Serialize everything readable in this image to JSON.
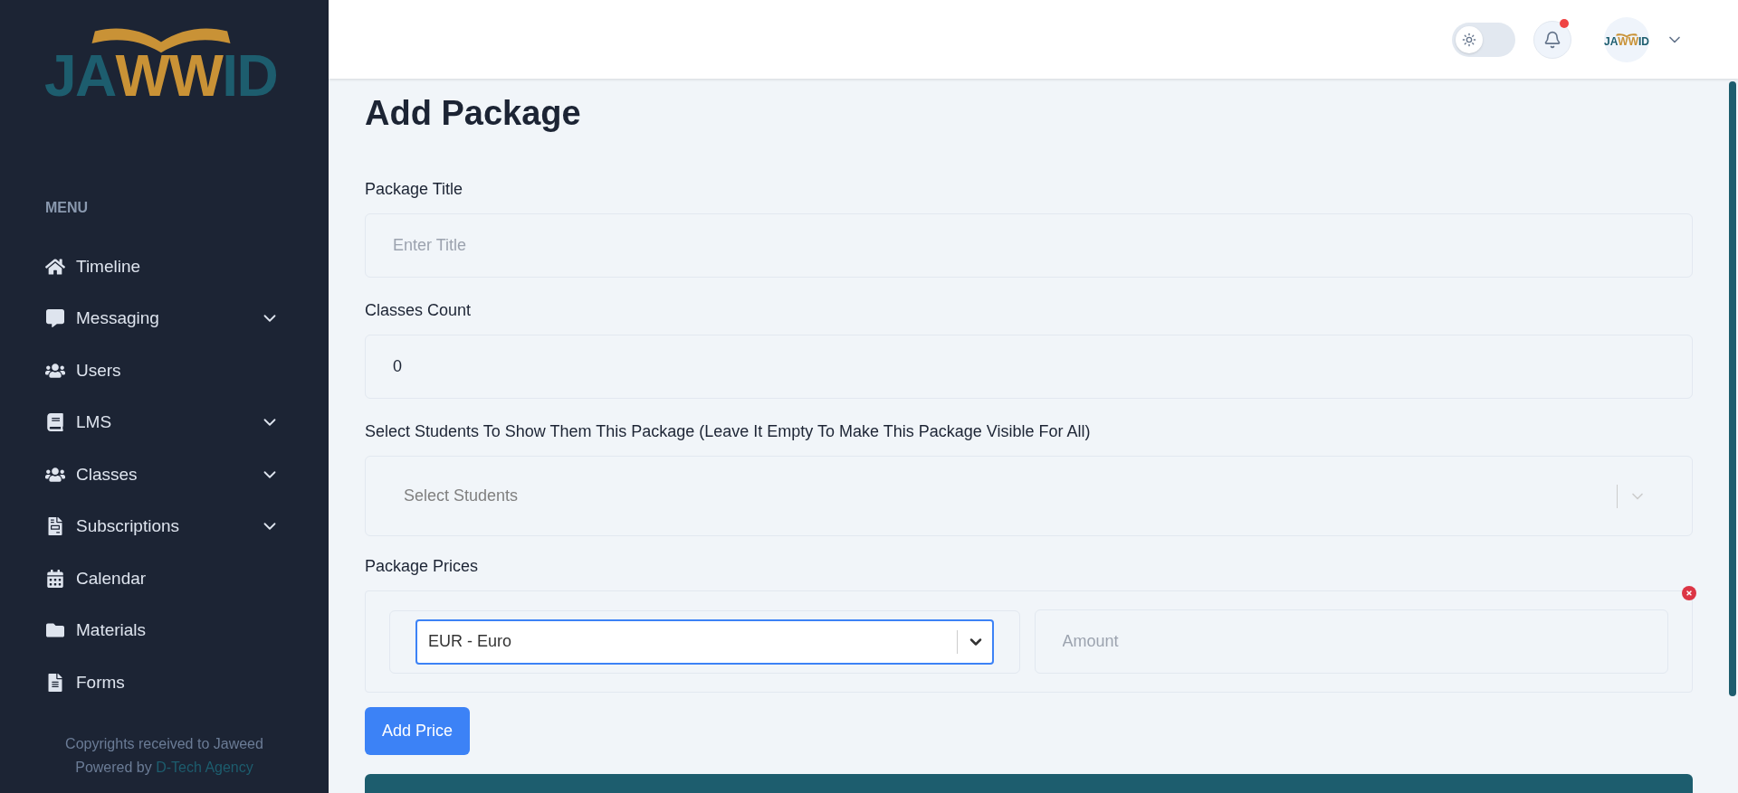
{
  "sidebar": {
    "logo": {
      "parts": [
        {
          "text": "JA",
          "color": "#1d5d6e"
        },
        {
          "text": "WW",
          "color": "#c99236"
        },
        {
          "text": "ID",
          "color": "#1d5d6e"
        }
      ]
    },
    "menu_heading": "MENU",
    "items": [
      {
        "label": "Timeline",
        "has_submenu": false
      },
      {
        "label": "Messaging",
        "has_submenu": true
      },
      {
        "label": "Users",
        "has_submenu": false
      },
      {
        "label": "LMS",
        "has_submenu": true
      },
      {
        "label": "Classes",
        "has_submenu": true
      },
      {
        "label": "Subscriptions",
        "has_submenu": true
      },
      {
        "label": "Calendar",
        "has_submenu": false
      },
      {
        "label": "Materials",
        "has_submenu": false
      },
      {
        "label": "Forms",
        "has_submenu": false
      }
    ],
    "footer": {
      "line1": "Copyrights received to Jaweed",
      "prefix": "Powered by ",
      "link": "D-Tech Agency"
    }
  },
  "header": {
    "dark_mode": {
      "on": false
    },
    "notifications": {
      "unread": true
    },
    "avatar_logo": {
      "parts": [
        {
          "text": "JA",
          "color": "#1d5d6e"
        },
        {
          "text": "WW",
          "color": "#c99236"
        },
        {
          "text": "ID",
          "color": "#1d5d6e"
        }
      ]
    }
  },
  "page_title": "Add Package",
  "fields": [
    {
      "label": "Package Title",
      "kind": "text",
      "placeholder": "Enter Title"
    },
    {
      "label": "Classes Count",
      "kind": "text",
      "value": "0"
    },
    {
      "label": "Select Students To Show Them This Package (Leave It Empty To Make This Package Visible For All)",
      "kind": "select",
      "placeholder": "Select Students"
    }
  ],
  "prices": {
    "label": "Package Prices",
    "rows": [
      {
        "currency": "EUR - Euro",
        "focused": true,
        "amount_placeholder": "Amount"
      }
    ],
    "add_button": "Add Price"
  }
}
